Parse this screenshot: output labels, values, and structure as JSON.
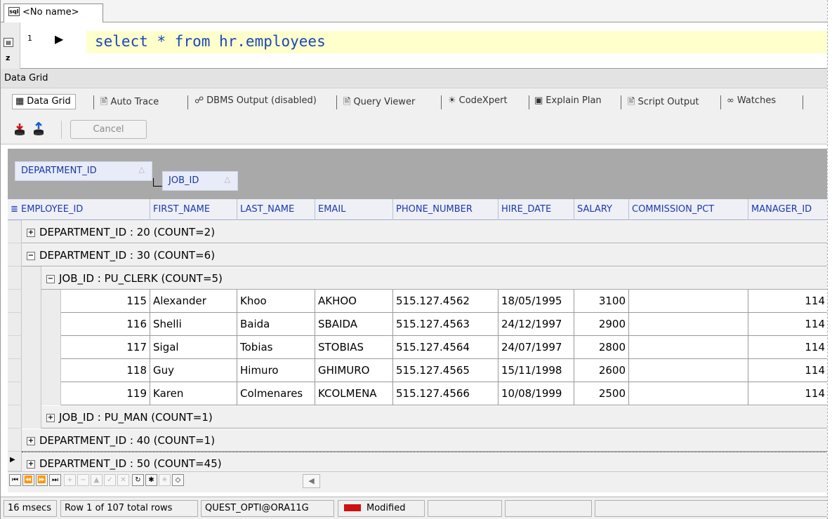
{
  "tab": {
    "badge": "sql",
    "title": "<No name>"
  },
  "editor": {
    "gutter_icon": "▤",
    "gutter_z": "z",
    "line_number": "1",
    "arrow": "▶",
    "sql": "select * from hr.employees"
  },
  "section_title": "Data Grid",
  "subtabs": [
    {
      "icon": "▦",
      "label": "Data Grid"
    },
    {
      "icon": "🖹",
      "label": "Auto Trace"
    },
    {
      "icon": "☍",
      "label": "DBMS Output (disabled)"
    },
    {
      "icon": "🖹",
      "label": "Query Viewer"
    },
    {
      "icon": "☀",
      "label": "CodeXpert"
    },
    {
      "icon": "▣",
      "label": "Explain Plan"
    },
    {
      "icon": "🖹",
      "label": "Script Output"
    },
    {
      "icon": "∞",
      "label": "Watches"
    }
  ],
  "toolbar": {
    "cancel_label": "Cancel"
  },
  "groupby": {
    "chip1": "DEPARTMENT_ID",
    "chip2": "JOB_ID",
    "sort_arrow": "△"
  },
  "columns": [
    "EMPLOYEE_ID",
    "FIRST_NAME",
    "LAST_NAME",
    "EMAIL",
    "PHONE_NUMBER",
    "HIRE_DATE",
    "SALARY",
    "COMMISSION_PCT",
    "MANAGER_ID"
  ],
  "groups": {
    "dept20": {
      "toggle": "+",
      "label": "DEPARTMENT_ID : 20 (COUNT=2)"
    },
    "dept30": {
      "toggle": "−",
      "label": "DEPARTMENT_ID : 30 (COUNT=6)"
    },
    "job_clerk": {
      "toggle": "−",
      "label": "JOB_ID : PU_CLERK (COUNT=5)"
    },
    "job_man": {
      "toggle": "+",
      "label": "JOB_ID : PU_MAN (COUNT=1)"
    },
    "dept40": {
      "toggle": "+",
      "label": "DEPARTMENT_ID : 40 (COUNT=1)"
    },
    "dept50": {
      "toggle": "+",
      "label": "DEPARTMENT_ID : 50 (COUNT=45)"
    }
  },
  "rows": [
    {
      "id": "115",
      "first": "Alexander",
      "last": "Khoo",
      "email": "AKHOO",
      "phone": "515.127.4562",
      "hire": "18/05/1995",
      "salary": "3100",
      "commission": "",
      "manager": "114"
    },
    {
      "id": "116",
      "first": "Shelli",
      "last": "Baida",
      "email": "SBAIDA",
      "phone": "515.127.4563",
      "hire": "24/12/1997",
      "salary": "2900",
      "commission": "",
      "manager": "114"
    },
    {
      "id": "117",
      "first": "Sigal",
      "last": "Tobias",
      "email": "STOBIAS",
      "phone": "515.127.4564",
      "hire": "24/07/1997",
      "salary": "2800",
      "commission": "",
      "manager": "114"
    },
    {
      "id": "118",
      "first": "Guy",
      "last": "Himuro",
      "email": "GHIMURO",
      "phone": "515.127.4565",
      "hire": "15/11/1998",
      "salary": "2600",
      "commission": "",
      "manager": "114"
    },
    {
      "id": "119",
      "first": "Karen",
      "last": "Colmenares",
      "email": "KCOLMENA",
      "phone": "515.127.4566",
      "hire": "10/08/1999",
      "salary": "2500",
      "commission": "",
      "manager": "114"
    }
  ],
  "row_indicator": "▶",
  "navigator": [
    "⏮",
    "⏪",
    "⏩",
    "⏭",
    "+",
    "−",
    "▲",
    "✓",
    "✕",
    "↻",
    "✱",
    "✳",
    "◇"
  ],
  "hscroll_left": "◀",
  "status": {
    "time": "16 msecs",
    "rows": "Row 1 of 107 total rows",
    "connection": "QUEST_OPTI@ORA11G",
    "state": "Modified"
  },
  "colors": {
    "accent_blue": "#1c39b0",
    "sql_blue": "#1a47b8",
    "editor_highlight": "#ffffcc",
    "group_bg": "#a9a9a9"
  }
}
